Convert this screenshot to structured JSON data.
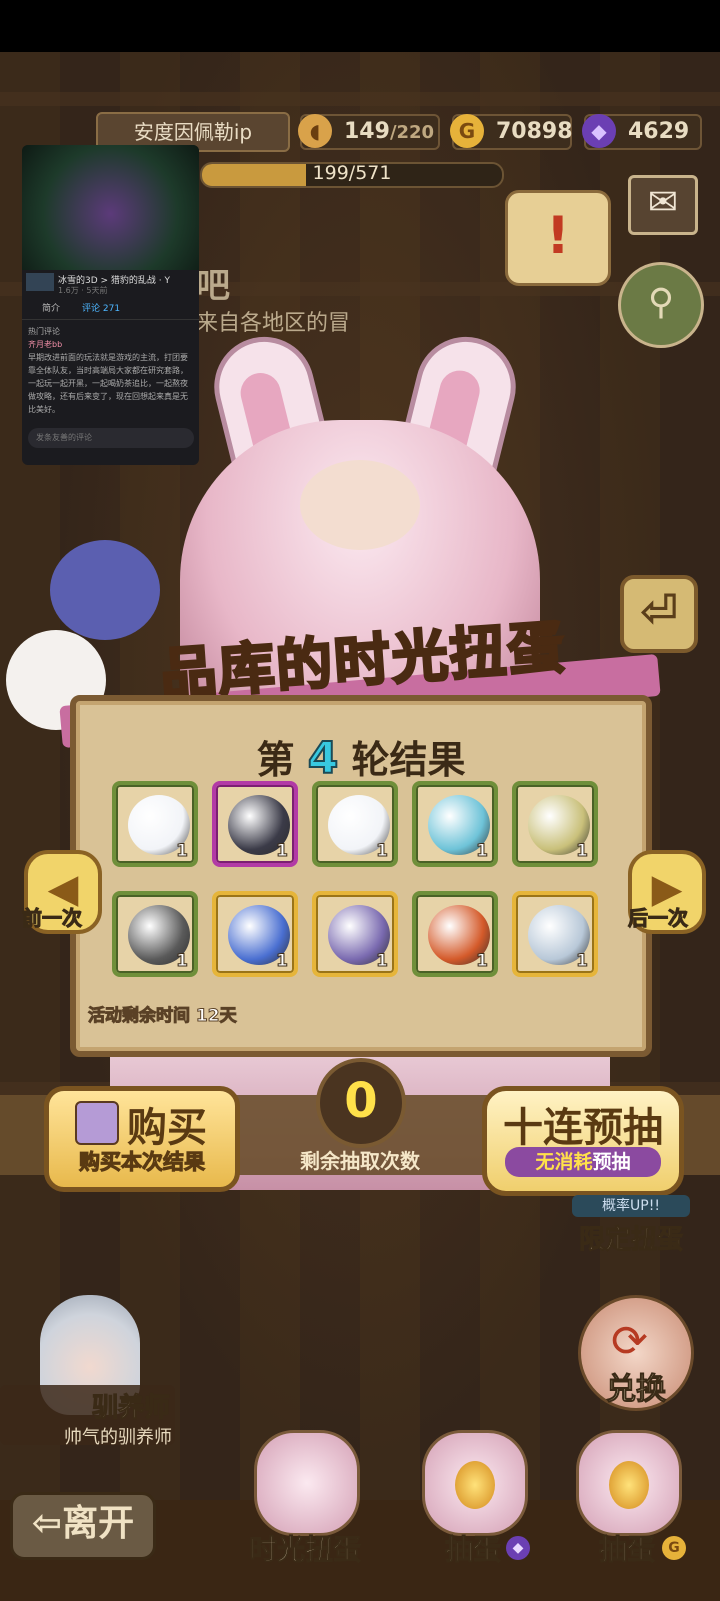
{
  "header": {
    "player_name": "安度因佩勒ip",
    "stamina": "149",
    "stamina_max": "/220",
    "gold": "70898",
    "gems": "4629",
    "xp": "199/571",
    "xp_fraction": 0.348
  },
  "background": {
    "text1": "吧",
    "text2": "来自各地区的冒"
  },
  "overlay": {
    "video_title": "冰雪的3D > 猎豹的乱战 · Y",
    "video_meta": "1.6万 · 5天前",
    "tab1": "简介",
    "tab2": "评论 271",
    "comment_header": "热门评论",
    "comment_user": "齐月老bb",
    "comment_text": "早期改进前面的玩法就是游戏的主流，打团要靠全体队友，当时高端局大家都在研究套路，一起玩一起开黑，一起喝奶茶追比，一起熬夜做攻略，还有后来变了，现在回想起来真是无比美好。",
    "input_placeholder": "发条友善的评论"
  },
  "title": {
    "part1": "品库的",
    "highlight": "时光",
    "part2": "扭蛋"
  },
  "results": {
    "round_prefix": "第",
    "round_number": "4",
    "round_suffix": "轮结果",
    "items": [
      {
        "name": "cloud-planet",
        "count": "1",
        "rarity": "green",
        "color": "#f2f4f8"
      },
      {
        "name": "spiked-helmet",
        "count": "1",
        "rarity": "purple",
        "color": "#3b3b48"
      },
      {
        "name": "cloud-planet",
        "count": "1",
        "rarity": "green",
        "color": "#f2f4f8"
      },
      {
        "name": "spiral-shell",
        "count": "1",
        "rarity": "green",
        "color": "#6ec3d8"
      },
      {
        "name": "leaf-egg",
        "count": "1",
        "rarity": "green",
        "color": "#c9c07a"
      },
      {
        "name": "stone-hat",
        "count": "1",
        "rarity": "green",
        "color": "#5a5a5a"
      },
      {
        "name": "blue-claw-helm",
        "count": "1",
        "rarity": "gold",
        "color": "#4a6fd1"
      },
      {
        "name": "moon-leaf",
        "count": "1",
        "rarity": "gold",
        "color": "#7a6ab0"
      },
      {
        "name": "flame-egg",
        "count": "1",
        "rarity": "green",
        "color": "#d45a2a"
      },
      {
        "name": "pocket-watch",
        "count": "1",
        "rarity": "gold",
        "color": "#b8c8d8"
      }
    ],
    "time_label": "活动剩余时间",
    "time_value": "12天"
  },
  "nav": {
    "prev": "前一次",
    "next": "后一次"
  },
  "actions": {
    "buy_title": "购买",
    "buy_sub": "购买本次结果",
    "remaining_count": "0",
    "remaining_label": "剩余抽取次数",
    "ten_title": "十连预抽",
    "ten_sub_hl": "无消耗",
    "ten_sub": "预抽"
  },
  "side": {
    "limited_top": "概率UP!!",
    "limited_main": "限定扭蛋",
    "exchange": "兑换"
  },
  "trainer": {
    "title": "驯养师",
    "subtitle": "帅气的驯养师"
  },
  "bottom": {
    "leave": "离开",
    "menu1": "时光扭蛋",
    "menu2": "抽蛋",
    "menu3": "抽蛋"
  }
}
